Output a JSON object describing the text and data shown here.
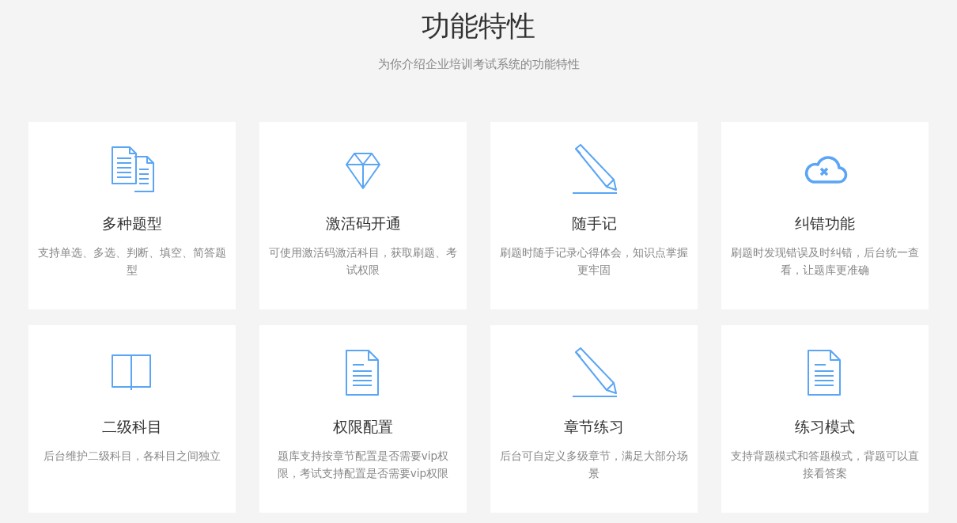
{
  "header": {
    "title": "功能特性",
    "subtitle": "为你介绍企业培训考试系统的功能特性"
  },
  "features": [
    {
      "kind": "documents",
      "title": "多种题型",
      "description": "支持单选、多选、判断、填空、简答题型"
    },
    {
      "kind": "diamond",
      "title": "激活码开通",
      "description": "可使用激活码激活科目，获取刷题、考试权限"
    },
    {
      "kind": "pencil",
      "title": "随手记",
      "description": "刷题时随手记录心得体会，知识点掌握更牢固"
    },
    {
      "kind": "cloud",
      "title": "纠错功能",
      "description": "刷题时发现错误及时纠错，后台统一查看，让题库更准确"
    },
    {
      "kind": "book",
      "title": "二级科目",
      "description": "后台维护二级科目，各科目之间独立"
    },
    {
      "kind": "document",
      "title": "权限配置",
      "description": "题库支持按章节配置是否需要vip权限，考试支持配置是否需要vip权限"
    },
    {
      "kind": "pencil",
      "title": "章节练习",
      "description": "后台可自定义多级章节，满足大部分场景"
    },
    {
      "kind": "document",
      "title": "练习模式",
      "description": "支持背题模式和答题模式，背题可以直接看答案"
    }
  ]
}
